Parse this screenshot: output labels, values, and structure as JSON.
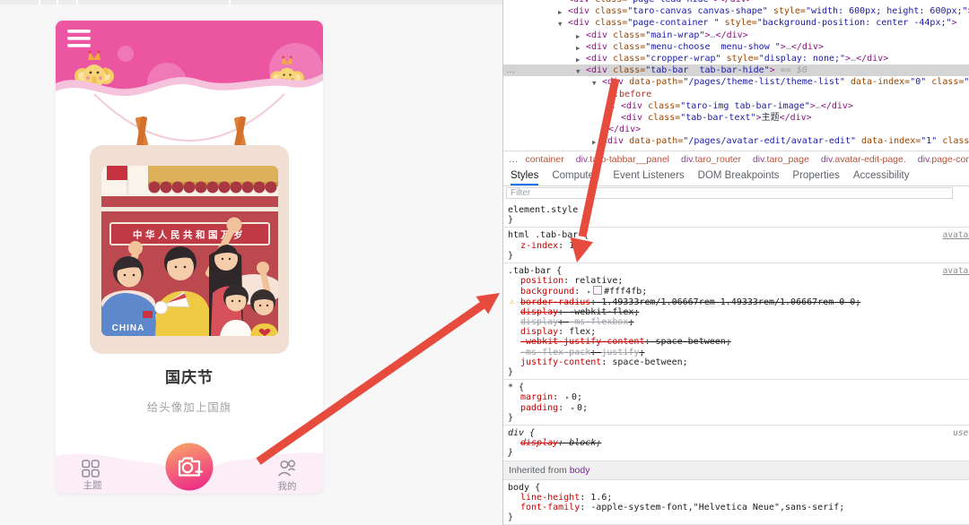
{
  "phone": {
    "title": "国庆节",
    "subtitle": "给头像加上国旗",
    "banner_text": "中华人民共和国万岁",
    "shirt_text": "CHINA",
    "tab_theme": "主题",
    "tab_mine": "我的",
    "colors": {
      "header_pink": "#ec55a2",
      "header_circle": "#f078b6",
      "wave_pink": "#f6c3dc",
      "tabbar_bg": "#fdedf7",
      "button_top": "#f8a368",
      "button_bottom": "#ee2f86",
      "frame_cream": "#f0dfd2",
      "photo_red": "#bc4950",
      "clip_orange": "#e08138",
      "annotation_arrow": "#e64b3e"
    }
  },
  "devtools": {
    "gutter_ellipsis": "…",
    "tree": [
      {
        "ind": 72,
        "exp": "",
        "parts": [
          [
            "t",
            "<div"
          ],
          [
            "a",
            " class="
          ],
          [
            "v",
            "\"page-lead-hide\""
          ],
          [
            "t",
            "></div>"
          ]
        ]
      },
      {
        "ind": 72,
        "exp": ">",
        "parts": [
          [
            "t",
            "<div"
          ],
          [
            "a",
            " class="
          ],
          [
            "v",
            "\"taro-canvas canvas-shape\""
          ],
          [
            "a",
            " style="
          ],
          [
            "v",
            "\"width: 600px; height: 600px;\""
          ],
          [
            "t",
            ">"
          ],
          [
            "g",
            "…"
          ],
          [
            "t",
            "</div>"
          ]
        ]
      },
      {
        "ind": 72,
        "exp": "v",
        "parts": [
          [
            "t",
            "<div"
          ],
          [
            "a",
            " class="
          ],
          [
            "v",
            "\"page-container \""
          ],
          [
            "a",
            " style="
          ],
          [
            "v",
            "\"background-position: center -44px;\""
          ],
          [
            "t",
            ">"
          ]
        ]
      },
      {
        "ind": 92,
        "exp": ">",
        "parts": [
          [
            "t",
            "<div"
          ],
          [
            "a",
            " class="
          ],
          [
            "v",
            "\"main-wrap\""
          ],
          [
            "t",
            ">"
          ],
          [
            "g",
            "…"
          ],
          [
            "t",
            "</div>"
          ]
        ]
      },
      {
        "ind": 92,
        "exp": ">",
        "parts": [
          [
            "t",
            "<div"
          ],
          [
            "a",
            " class="
          ],
          [
            "v",
            "\"menu-choose  menu-show \""
          ],
          [
            "t",
            ">"
          ],
          [
            "g",
            "…"
          ],
          [
            "t",
            "</div>"
          ]
        ]
      },
      {
        "ind": 92,
        "exp": ">",
        "parts": [
          [
            "t",
            "<div"
          ],
          [
            "a",
            " class="
          ],
          [
            "v",
            "\"cropper-wrap\""
          ],
          [
            "a",
            " style="
          ],
          [
            "v",
            "\"display: none;\""
          ],
          [
            "t",
            ">"
          ],
          [
            "g",
            "…"
          ],
          [
            "t",
            "</div>"
          ]
        ]
      },
      {
        "ind": 92,
        "exp": "v",
        "sel": true,
        "parts": [
          [
            "t",
            "<div"
          ],
          [
            "a",
            " class="
          ],
          [
            "v",
            "\"tab-bar  tab-bar-hide\""
          ],
          [
            "t",
            ">"
          ],
          [
            "i",
            " == $0"
          ]
        ]
      },
      {
        "ind": 110,
        "exp": "v",
        "parts": [
          [
            "t",
            "<div"
          ],
          [
            "a",
            " data-path="
          ],
          [
            "v",
            "\"/pages/theme-list/theme-list\""
          ],
          [
            "a",
            " data-index="
          ],
          [
            "v",
            "\"0\""
          ],
          [
            "a",
            " class="
          ],
          [
            "v",
            "\"tab-b"
          ]
        ]
      },
      {
        "ind": 117,
        "exp": "",
        "parts": [
          [
            "p",
            "::before"
          ]
        ]
      },
      {
        "ind": 131,
        "exp": ">",
        "parts": [
          [
            "t",
            "<div"
          ],
          [
            "a",
            " class="
          ],
          [
            "v",
            "\"taro-img tab-bar-image\""
          ],
          [
            "t",
            ">"
          ],
          [
            "g",
            "…"
          ],
          [
            "t",
            "</div>"
          ]
        ]
      },
      {
        "ind": 131,
        "exp": "",
        "parts": [
          [
            "t",
            "<div"
          ],
          [
            "a",
            " class="
          ],
          [
            "v",
            "\"tab-bar-text\""
          ],
          [
            "t",
            ">"
          ],
          [
            "x",
            "主题"
          ],
          [
            "t",
            "</div>"
          ]
        ]
      },
      {
        "ind": 117,
        "exp": "",
        "parts": [
          [
            "t",
            "</div>"
          ]
        ]
      },
      {
        "ind": 110,
        "exp": ">",
        "parts": [
          [
            "t",
            "<div"
          ],
          [
            "a",
            " data-path="
          ],
          [
            "v",
            "\"/pages/avatar-edit/avatar-edit\""
          ],
          [
            "a",
            " data-index="
          ],
          [
            "v",
            "\"1\""
          ],
          [
            "a",
            " class="
          ],
          [
            "v",
            "\"tab"
          ]
        ]
      }
    ],
    "crumbs": {
      "overflow": "…",
      "items": [
        {
          "tag": "",
          "cls": "container"
        },
        {
          "tag": "div",
          "cls": ".taro-tabbar__panel"
        },
        {
          "tag": "div",
          "cls": ".taro_router"
        },
        {
          "tag": "div",
          "cls": ".taro_page"
        },
        {
          "tag": "div",
          "cls": ".avatar-edit-page."
        },
        {
          "tag": "div",
          "cls": ".page-container."
        },
        {
          "tag": "div",
          "cls": "."
        }
      ]
    },
    "tabs": [
      "Styles",
      "Computed",
      "Event Listeners",
      "DOM Breakpoints",
      "Properties",
      "Accessibility"
    ],
    "active_tab": "Styles",
    "filter_placeholder": "Filter",
    "filter_right_partial": ":",
    "rules": [
      {
        "selector": "element.style",
        "link": "",
        "props": []
      },
      {
        "selector": "html .tab-bar",
        "link": "avatar",
        "props": [
          {
            "n": "z-index",
            "v": "10"
          }
        ]
      },
      {
        "selector": ".tab-bar",
        "link": "avatar",
        "props": [
          {
            "n": "position",
            "v": "relative"
          },
          {
            "n": "background",
            "v": "#fff4fb",
            "exp": true,
            "swatch": "#fff4fb"
          },
          {
            "n": "border-radius",
            "v": "1.49333rem/1.06667rem 1.49333rem/1.06667rem 0 0",
            "struck": true,
            "warn": true
          },
          {
            "n": "display",
            "v": "-webkit-flex",
            "struck": true
          },
          {
            "n": "display",
            "v": "-ms-flexbox",
            "struck": true,
            "dim": true
          },
          {
            "n": "display",
            "v": "flex"
          },
          {
            "n": "-webkit-justify-content",
            "v": "space-between",
            "struck": true
          },
          {
            "n": "-ms-flex-pack",
            "v": "justify",
            "struck": true,
            "dim": true
          },
          {
            "n": "justify-content",
            "v": "space-between"
          }
        ]
      },
      {
        "selector": "*",
        "link": "",
        "props": [
          {
            "n": "margin",
            "v": "0",
            "exp": true
          },
          {
            "n": "padding",
            "v": "0",
            "exp": true
          }
        ]
      },
      {
        "selector": "div",
        "link": "user",
        "ua": true,
        "props": [
          {
            "n": "display",
            "v": "block",
            "struck": true
          }
        ]
      },
      {
        "inherited": true,
        "label": "Inherited from",
        "from": "body"
      },
      {
        "selector": "body",
        "link": "",
        "props": [
          {
            "n": "line-height",
            "v": "1.6"
          },
          {
            "n": "font-family",
            "v": "-apple-system-font,\"Helvetica Neue\",sans-serif"
          }
        ]
      }
    ]
  }
}
